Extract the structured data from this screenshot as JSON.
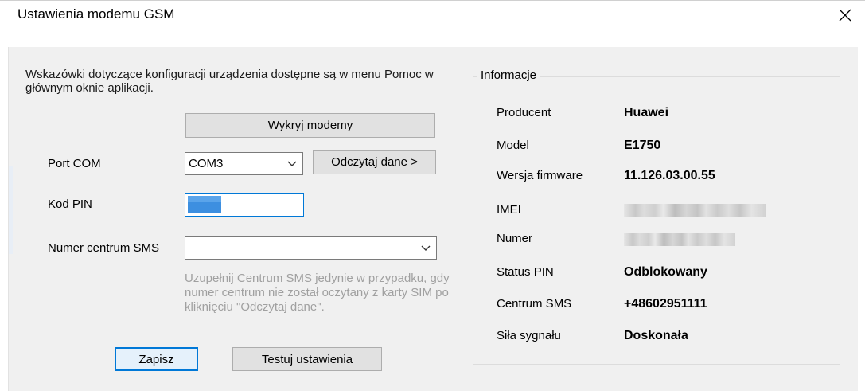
{
  "window": {
    "title": "Ustawienia modemu GSM"
  },
  "hint": "Wskazówki dotyczące konfiguracji urządzenia dostępne są w menu Pomoc w głównym oknie aplikacji.",
  "buttons": {
    "detect": "Wykryj modemy",
    "read": "Odczytaj dane >",
    "save": "Zapisz",
    "test": "Testuj ustawienia"
  },
  "form": {
    "port_label": "Port COM",
    "port_value": "COM3",
    "pin_label": "Kod PIN",
    "sms_label": "Numer centrum SMS",
    "sms_value": "",
    "sms_hint": "Uzupełnij Centrum SMS jedynie w przypadku, gdy numer centrum nie został oczytany z karty SIM po kliknięciu \"Odczytaj dane\"."
  },
  "info": {
    "title": "Informacje",
    "rows": [
      {
        "label": "Producent",
        "value": "Huawei"
      },
      {
        "label": "Model",
        "value": "E1750"
      },
      {
        "label": "Wersja firmware",
        "value": "11.126.03.00.55"
      },
      {
        "label": "IMEI",
        "value": ""
      },
      {
        "label": "Numer",
        "value": ""
      },
      {
        "label": "Status PIN",
        "value": "Odblokowany"
      },
      {
        "label": "Centrum SMS",
        "value": "+48602951111"
      },
      {
        "label": "Siła sygnału",
        "value": "Doskonała"
      }
    ]
  },
  "icons": {
    "close": "close-icon",
    "dropdown": "chevron-down-icon"
  }
}
